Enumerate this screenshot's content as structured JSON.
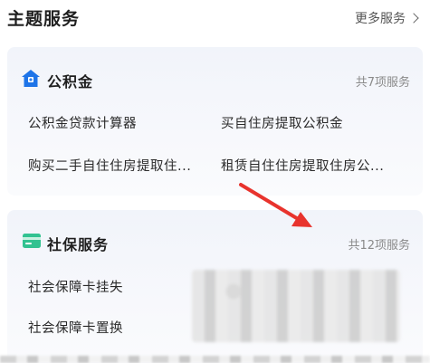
{
  "header": {
    "title": "主题服务",
    "more_label": "更多服务"
  },
  "cards": [
    {
      "title": "公积金",
      "icon": "house-icon",
      "count_label": "共7项服务",
      "items": [
        "公积金贷款计算器",
        "买自住房提取公积金",
        "购买二手自住住房提取住...",
        "租赁自住住房提取住房公..."
      ]
    },
    {
      "title": "社保服务",
      "icon": "card-icon",
      "count_label": "共12项服务",
      "items": [
        "社会保障卡挂失",
        "社会保障卡置换"
      ]
    }
  ],
  "colors": {
    "accent_blue": "#1e74e8",
    "accent_green": "#32c291",
    "annotation_arrow": "#e8332d"
  }
}
